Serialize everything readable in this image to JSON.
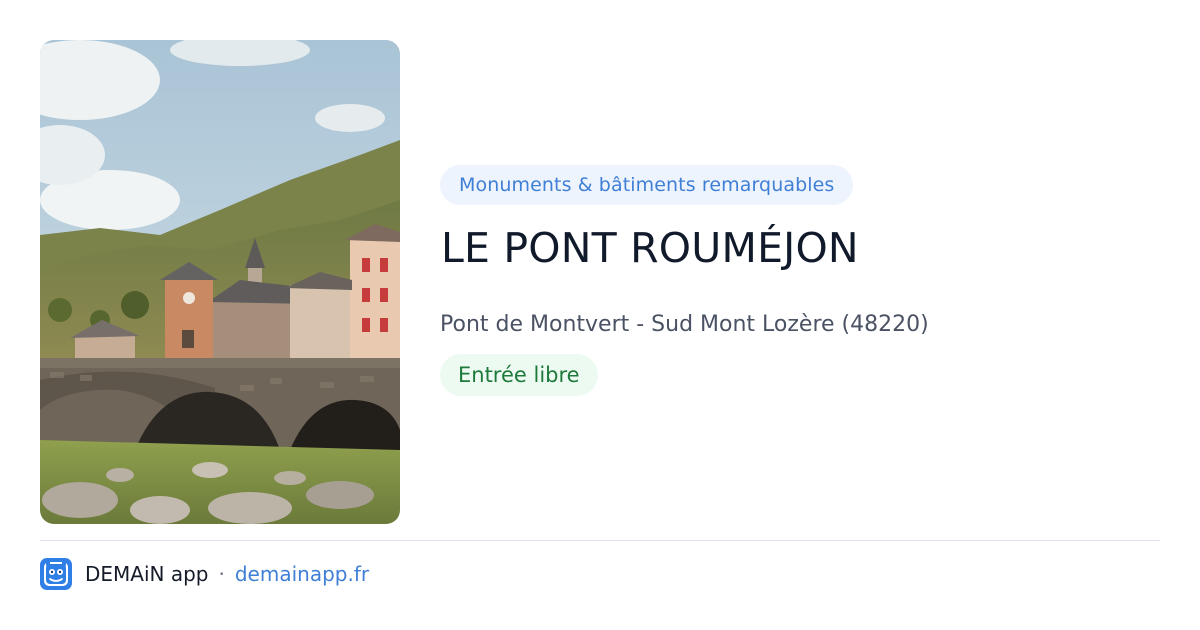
{
  "card": {
    "category": "Monuments & bâtiments remarquables",
    "title": "LE PONT ROUMÉJON",
    "address": "Pont de Montvert - Sud Mont Lozère (48220)",
    "access": "Entrée libre"
  },
  "footer": {
    "app_name": "DEMAiN app",
    "separator": "·",
    "domain": "demainapp.fr"
  },
  "icons": {
    "app_logo": "demain-logo-icon"
  },
  "colors": {
    "category_badge_bg": "#eef4fd",
    "category_badge_text": "#3f7fd6",
    "access_badge_bg": "#edfaf1",
    "access_badge_text": "#1e7a3b",
    "link": "#3f7fd6",
    "title": "#111a2b"
  }
}
